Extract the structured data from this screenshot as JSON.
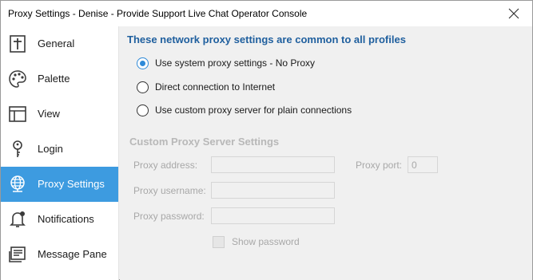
{
  "window": {
    "title": "Proxy Settings - Denise - Provide Support Live Chat Operator Console"
  },
  "sidebar": {
    "items": [
      {
        "label": "General",
        "icon": "general-icon"
      },
      {
        "label": "Palette",
        "icon": "palette-icon"
      },
      {
        "label": "View",
        "icon": "view-icon"
      },
      {
        "label": "Login",
        "icon": "key-icon"
      },
      {
        "label": "Proxy Settings",
        "icon": "globe-icon",
        "active": true
      },
      {
        "label": "Notifications",
        "icon": "bell-icon"
      },
      {
        "label": "Message Pane",
        "icon": "message-pane-icon"
      }
    ]
  },
  "main": {
    "heading": "These network proxy settings are common to all profiles",
    "options": [
      {
        "label": "Use system proxy settings - No Proxy",
        "selected": true
      },
      {
        "label": "Direct connection to Internet",
        "selected": false
      },
      {
        "label": "Use custom proxy server for plain connections",
        "selected": false
      }
    ],
    "custom": {
      "heading": "Custom Proxy Server Settings",
      "address_label": "Proxy address:",
      "address_value": "",
      "port_label": "Proxy port:",
      "port_value": "0",
      "username_label": "Proxy username:",
      "username_value": "",
      "password_label": "Proxy password:",
      "password_value": "",
      "show_password_label": "Show password",
      "show_password_checked": false
    }
  },
  "colors": {
    "active_item": "#3d9be0",
    "heading": "#1f5f9e",
    "radio_accent": "#2e8ad8",
    "disabled_text": "#a8a8a8"
  }
}
